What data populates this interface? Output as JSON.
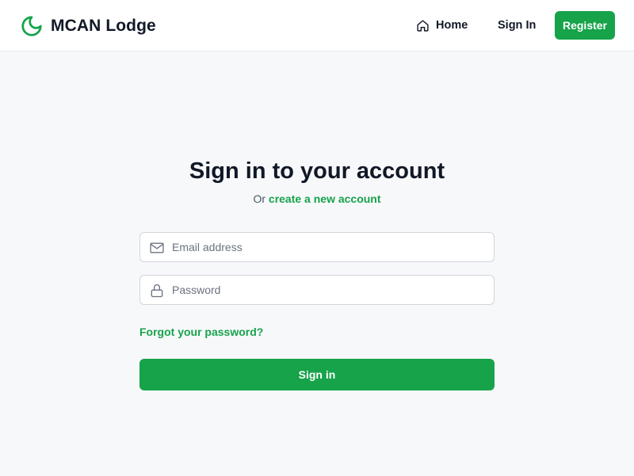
{
  "colors": {
    "accent": "#16a34a",
    "page_background": "#f7f8fa",
    "header_background": "#ffffff",
    "heading_text": "#111827",
    "muted_text": "#4b5563"
  },
  "header": {
    "brand": {
      "icon": "crescent-moon-icon",
      "name": "MCAN Lodge"
    },
    "nav": {
      "home": {
        "icon": "home-icon",
        "label": "Home"
      },
      "signin_label": "Sign In",
      "register_label": "Register"
    }
  },
  "main": {
    "title": "Sign in to your account",
    "subtitle_prefix": "Or",
    "subtitle_link": "create a new account",
    "form": {
      "email": {
        "icon": "envelope-icon",
        "placeholder": "Email address",
        "value": ""
      },
      "password": {
        "icon": "lock-icon",
        "placeholder": "Password",
        "value": ""
      },
      "forgot_label": "Forgot your password?",
      "submit_label": "Sign in"
    }
  }
}
